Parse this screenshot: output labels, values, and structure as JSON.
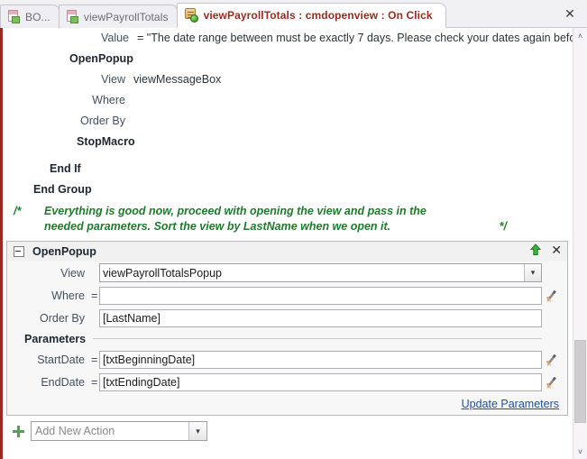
{
  "window": {
    "close_label": "✕"
  },
  "tabs": [
    {
      "label": "BO...",
      "icon": "document-icon",
      "active": false
    },
    {
      "label": "viewPayrollTotals",
      "icon": "document-icon",
      "active": false
    },
    {
      "label": "viewPayrollTotals : cmdopenview : On Click",
      "icon": "macro-icon",
      "active": true
    }
  ],
  "macro_lines": [
    {
      "kind": "arg",
      "label": "Value",
      "eq": "=",
      "value": "\"The date range between must be exactly 7 days. Please check your dates again befo…",
      "indent": 96,
      "label_width": 44
    },
    {
      "kind": "action",
      "label": "OpenPopup",
      "indent": 74
    },
    {
      "kind": "arg",
      "label": "View",
      "eq": "",
      "value": "viewMessageBox",
      "indent": 104,
      "label_width": 36
    },
    {
      "kind": "arg",
      "label": "Where",
      "eq": "",
      "value": "",
      "indent": 81,
      "label_width": 44
    },
    {
      "kind": "arg",
      "label": "Order By",
      "eq": "",
      "value": "",
      "indent": 70,
      "label_width": 56
    },
    {
      "kind": "action",
      "label": "StopMacro",
      "indent": 82
    },
    {
      "kind": "action",
      "label": "End If",
      "indent": 52
    },
    {
      "kind": "action",
      "label": "End Group",
      "indent": 36
    }
  ],
  "comment": {
    "open": "/*",
    "text": "Everything is good now, proceed with opening the view and pass in the needed parameters. Sort the view by LastName when we open it.",
    "close": "*/"
  },
  "action_block": {
    "title": "OpenPopup",
    "move_up_icon": "move-up-arrow-icon",
    "delete_icon": "delete-action-icon",
    "rows": [
      {
        "label": "View",
        "eq": "",
        "value": "viewPayrollTotalsPopup",
        "control": "combo"
      },
      {
        "label": "Where",
        "eq": "=",
        "value": "",
        "control": "textbox",
        "builder": true
      },
      {
        "label": "Order By",
        "eq": "",
        "value": "[LastName]",
        "control": "textbox",
        "builder": false
      }
    ],
    "parameters_title": "Parameters",
    "parameters": [
      {
        "label": "StartDate",
        "eq": "=",
        "value": "[txtBeginningDate]",
        "builder": true
      },
      {
        "label": "EndDate",
        "eq": "=",
        "value": "[txtEndingDate]",
        "builder": true
      }
    ],
    "update_parameters_label": "Update Parameters"
  },
  "add_action": {
    "plus_icon": "add-icon",
    "placeholder": "Add New Action",
    "value": ""
  },
  "scrollbar": {
    "up_arrow": "˄",
    "down_arrow": "˅"
  },
  "colors": {
    "active_tab_text": "#9c2a1e",
    "comment_green": "#1f7a2e",
    "link_blue": "#1f4fa3",
    "left_stripe": "#9c2a1e"
  }
}
